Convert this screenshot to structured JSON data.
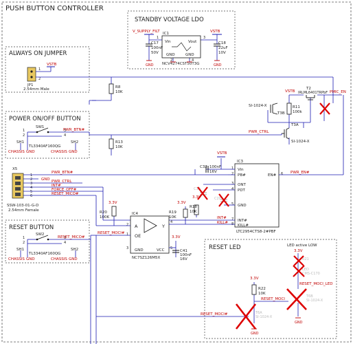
{
  "title": "PUSH BUTTON CONTROLLER",
  "sections": {
    "ldo": "STANDBY VOLTAGE LDO",
    "jumper": "ALWAYS ON JUMPER",
    "power_button": "POWER ON/OFF BUTTON",
    "reset_button": "RESET BUTTON",
    "reset_led": "RESET LED"
  },
  "ldo": {
    "vin_net": "V_SUPPLY_FILT",
    "vout_net": "VSTB",
    "ic": "IC1",
    "ic_part": "NCV4274CST50T3G",
    "pin_vin": "Vin",
    "pin_vout": "Vout",
    "pin_gnd1": "GND",
    "pin_gnd2": "GND",
    "pin1": "1",
    "pin2": "2",
    "pin3": "3",
    "pin4": "4",
    "c_in": "C17",
    "c_in_val": "100nF",
    "c_in_v": "50V",
    "c_out": "C18",
    "c_out_val": "22uF",
    "c_out_v": "10V",
    "gnd": "GND"
  },
  "jumper": {
    "net": "VSTB",
    "ref": "JP1",
    "desc": "2.54mm Male",
    "pin1": "1",
    "pin2": "2",
    "r_ref": "R8",
    "r_val": "10K"
  },
  "power_button": {
    "sw": "SW1",
    "sh1": "SH1",
    "sh2": "SH2",
    "part": "TL3340AF160QG",
    "chassis1": "CHASSIS",
    "gnd1": "GND",
    "chassis2": "CHASSIS",
    "gnd2": "GND",
    "net": "PWR_BTN#",
    "pin1": "1",
    "pin2": "2",
    "pin3": "3",
    "pin4": "4"
  },
  "mosfets": {
    "t2": "T2",
    "t2_part": "IRLML6401TRPbF",
    "r11": "R11",
    "r11_val": "100k",
    "t3b": "T3B",
    "t3a": "T3A",
    "si_top": "SI-1024-X",
    "si_bot": "SI-1024-X",
    "vstb": "VSTB",
    "pmic_en": "PMIC_EN",
    "pwr_ctrl": "PWR_CTRL",
    "r13": "R13",
    "r13_val": "10K"
  },
  "connector": {
    "ref": "X5",
    "part": "SSW-103-01-G-D",
    "desc": "2.54mm Female",
    "pins": [
      "1",
      "2",
      "3",
      "4",
      "5",
      "6"
    ],
    "nets": [
      "PWR_BTN#",
      "GND",
      "PWR_CTRL",
      "INT#",
      "FORCE_OFF#",
      "RESET_MICO#"
    ]
  },
  "ic3": {
    "ref": "IC3",
    "part": "LTC2954CTS8-2#PBF",
    "vin": "Vin",
    "pb": "PB#",
    "ont": "ONT",
    "pdt": "PDT",
    "gnd": "GND",
    "int": "INT#",
    "kill": "KILL#",
    "en": "EN#",
    "pin1": "1",
    "pin2": "2",
    "pin3": "3",
    "pin4": "4",
    "pin5": "5",
    "pin6": "6",
    "pin7": "7",
    "pin8": "8",
    "c32": "C32",
    "c32_val": "100nF",
    "c32_v": "16V",
    "vstb": "VSTB",
    "pwr_en": "PWR_EN#",
    "int_net": "INT#",
    "kill_net": "KILL#",
    "c19": "C19",
    "c20": "C20",
    "r18": "R18",
    "r18_val": "10K",
    "r19": "R19",
    "r19_val": "10K",
    "v33a": "3.3V",
    "v33b": "3.3V"
  },
  "buffer": {
    "ref": "IC4",
    "part": "NC7SZ126M5X",
    "a": "A",
    "oe": "OE",
    "y": "Y",
    "gnd": "GND",
    "vcc": "VCC",
    "pin1": "1",
    "pin2": "2",
    "pin3": "3",
    "pin4": "4",
    "pin5": "5",
    "r20": "R20",
    "r20_val": "100K",
    "v33": "3.3V",
    "c_ref": "C41",
    "c_val": "100nF",
    "c_v": "16V",
    "v33c": "3.3V",
    "net_in": "RESET_MOCI#"
  },
  "reset_button": {
    "sw": "SW2",
    "sh1": "SH1",
    "sh2": "SH2",
    "part": "TL3340AF160QG",
    "chassis1": "CHASSIS",
    "gnd1": "GND",
    "chassis2": "CHASSIS",
    "gnd2": "GND",
    "net": "RESET_MICO#",
    "pin1": "1",
    "pin2": "2",
    "pin3": "3",
    "pin4": "4"
  },
  "reset_led": {
    "note": "LED active LOW",
    "v33_top": "3.3V",
    "r21": "R21",
    "led": "LED",
    "led_part": "CMS-C170",
    "net_led": "RESET_MOCI_LED",
    "v33_left": "3.3V",
    "r22": "R22",
    "r22_val": "10K",
    "net_moci": "RESET_MOCI",
    "t6a": "T6A",
    "t6a_part": "SI-1024-X",
    "t6b": "T6B",
    "t6b_part": "SI-1024-X",
    "net_moci_hash": "RESET_MOCI#",
    "gnd": "GND"
  },
  "colors": {
    "wire": "#1a1ab0",
    "frame": "#333333",
    "red": "#cc0000",
    "accent": "#c00000"
  }
}
